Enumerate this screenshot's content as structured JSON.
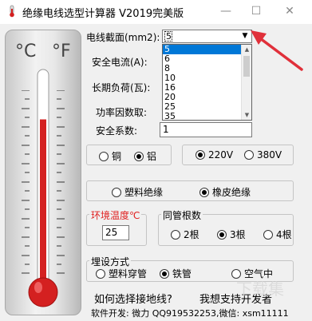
{
  "window": {
    "title": "绝缘电线选型计算器 V2019完美版",
    "icon": "thermometer-app-icon",
    "controls": {
      "minimize": "—",
      "maximize": "☐",
      "close": "✕"
    }
  },
  "thermometer": {
    "celsius_unit": "°C",
    "fahrenheit_unit": "°F",
    "mercury_color": "#d42020",
    "mercury_fill_fraction": 0.78
  },
  "form": {
    "cross_section_label": "电线截面(mm2):",
    "cross_section_value": "5",
    "cross_section_options": [
      "5",
      "6",
      "8",
      "10",
      "16",
      "20",
      "25",
      "35"
    ],
    "safe_current_label": "安全电流(A):",
    "long_term_load_label": "长期负荷(瓦):",
    "power_factor_label": "功率因数取:",
    "safety_factor_label": "安全系数:",
    "safety_factor_value": "1"
  },
  "material": {
    "copper": "铜",
    "aluminum": "铝",
    "selected": "aluminum"
  },
  "voltage": {
    "v220": "220V",
    "v380": "380V",
    "selected": "220V"
  },
  "insulation": {
    "plastic": "塑料绝缘",
    "rubber": "橡皮绝缘",
    "selected": "rubber"
  },
  "ambient": {
    "label": "环境温度℃",
    "value": "25",
    "label_color": "#e02020"
  },
  "conduit_count": {
    "label": "同管根数",
    "two": "2根",
    "three": "3根",
    "four": "4根",
    "selected": "three"
  },
  "laying": {
    "label": "埋设方式",
    "plastic_pipe": "塑料穿管",
    "iron_pipe": "铁管",
    "air": "空气中",
    "selected": "iron_pipe"
  },
  "links": {
    "ground_wire": "如何选择接地线?",
    "support_dev": "我想支持开发者"
  },
  "footer": {
    "developer_info": "软件开发: 微力 QQ919532253,微信: xsm11111"
  },
  "annotation": {
    "arrow_color": "#e0303a"
  },
  "watermark": "下载集"
}
